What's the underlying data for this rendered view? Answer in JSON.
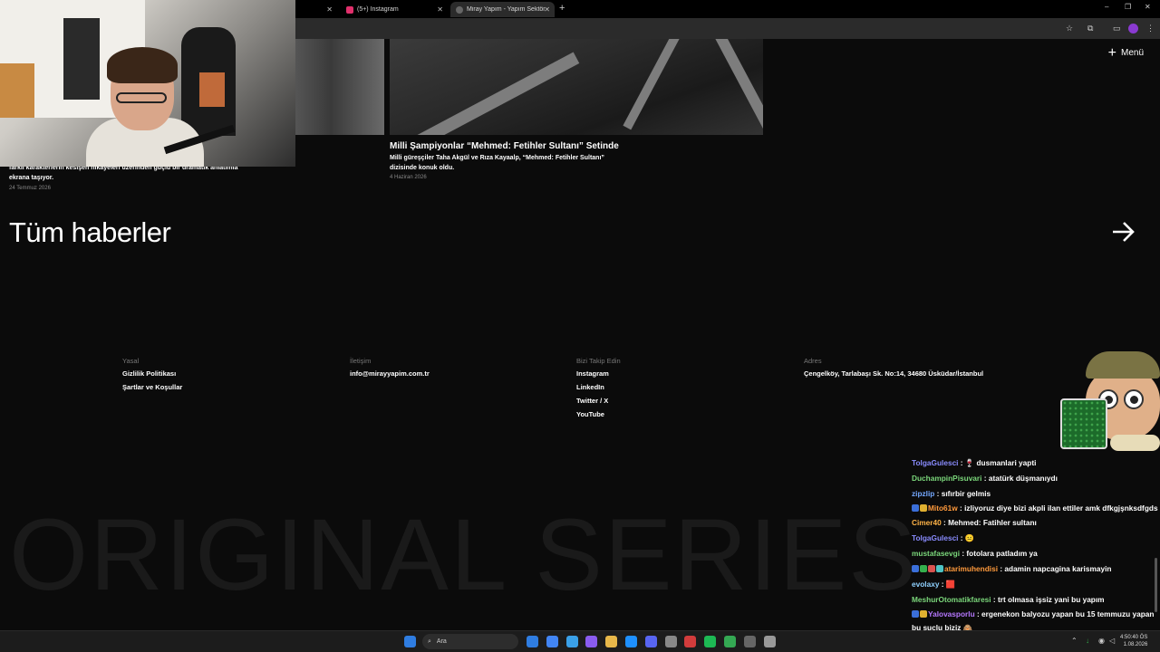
{
  "browser": {
    "tabs": [
      {
        "label": "",
        "close": "✕"
      },
      {
        "label": "(5+) Instagram",
        "close": "✕",
        "color": "#e1306c"
      },
      {
        "label": "Miray Yapım - Yapım Sektörünü",
        "close": "✕",
        "color": "#666666"
      }
    ],
    "new_tab": "+",
    "window_controls": {
      "minimize": "–",
      "restore": "❐",
      "close": "✕"
    }
  },
  "page": {
    "menu_label": "Menü",
    "menu_plus": "+",
    "card": {
      "title": "Milli Şampiyonlar “Mehmed: Fetihler Sultanı” Setinde",
      "desc": "Milli güreşçiler Taha Akgül ve Rıza Kayaalp, “Mehmed: Fetihler Sultanı” dizisinde konuk oldu.",
      "date": "4 Haziran 2026"
    },
    "left_card": {
      "desc": "farklı karakterlerin kesişen hikayeleri üzerinden güçlü bir dramatik anlatımla ekrana taşıyor.",
      "date": "24 Temmuz 2026"
    },
    "all_news": "Tüm haberler",
    "footer": {
      "cols": [
        {
          "head": "Yasal",
          "items": [
            "Gizlilik Politikası",
            "Şartlar ve Koşullar"
          ]
        },
        {
          "head": "İletişim",
          "items": [
            "info@mirayyapim.com.tr"
          ]
        },
        {
          "head": "Bizi Takip Edin",
          "items": [
            "Instagram",
            "LinkedIn",
            "Twitter / X",
            "YouTube"
          ]
        },
        {
          "head": "Adres",
          "items": [
            "Çengelköy, Tarlabaşı Sk. No:14, 34680 Üsküdar/İstanbul"
          ]
        }
      ]
    },
    "big_text": "ORIGINAL SERIES"
  },
  "chat": {
    "messages": [
      {
        "user": "TolgaGulesci",
        "color": "#8a8cff",
        "text": " : 🍷 dusmanlari yapti"
      },
      {
        "user": "DuchampinPisuvari",
        "color": "#7bd77b",
        "text": " : atatürk düşmanıydı"
      },
      {
        "user": "zipzlip",
        "color": "#74a8ff",
        "text": " : sıfırbir gelmis"
      },
      {
        "user": "Mito61w",
        "color": "#ff9a3c",
        "text": " : izliyoruz diye bizi akpli ilan ettiler amk dfkgjşnksdfgds",
        "badges": [
          "#3b6fd9",
          "#e0b030"
        ]
      },
      {
        "user": "Cimer40",
        "color": "#ffb347",
        "text": " : Mehmed: Fatihler sultanı"
      },
      {
        "user": "TolgaGulesci",
        "color": "#8a8cff",
        "text": " : 😐"
      },
      {
        "user": "mustafasevgi",
        "color": "#7bd77b",
        "text": " : fotolara patladım ya"
      },
      {
        "user": "atarimuhendisi",
        "color": "#ff9a3c",
        "text": " : adamin napcagina karismayin",
        "badges": [
          "#3b6fd9",
          "#35b04d",
          "#d9534f",
          "#4dc4c4"
        ]
      },
      {
        "user": "evolaxy",
        "color": "#8fd1ff",
        "text": " : 🟥"
      },
      {
        "user": "MeshurOtomatikfaresi",
        "color": "#7bd77b",
        "text": " : trt olmasa işsiz yani bu yapım"
      },
      {
        "user": "Yalovasporlu",
        "color": "#b678ff",
        "text": " : ergenekon balyozu yapan bu 15 temmuzu yapan bu suclu biziz 🙈",
        "badges": [
          "#3b6fd9",
          "#e0b030"
        ]
      }
    ]
  },
  "taskbar": {
    "search_label": "Ara",
    "clock_time": "4:50:40 ÖS",
    "clock_date": "1.08.2026",
    "apps": [
      "#2f7de1",
      "#4285f4",
      "#3aa0e8",
      "#8a5cf0",
      "#e8b84a",
      "#1e90ff",
      "#5865f2",
      "#888888",
      "#d23c3c",
      "#1db954",
      "#34a853",
      "#666666",
      "#999999"
    ]
  }
}
